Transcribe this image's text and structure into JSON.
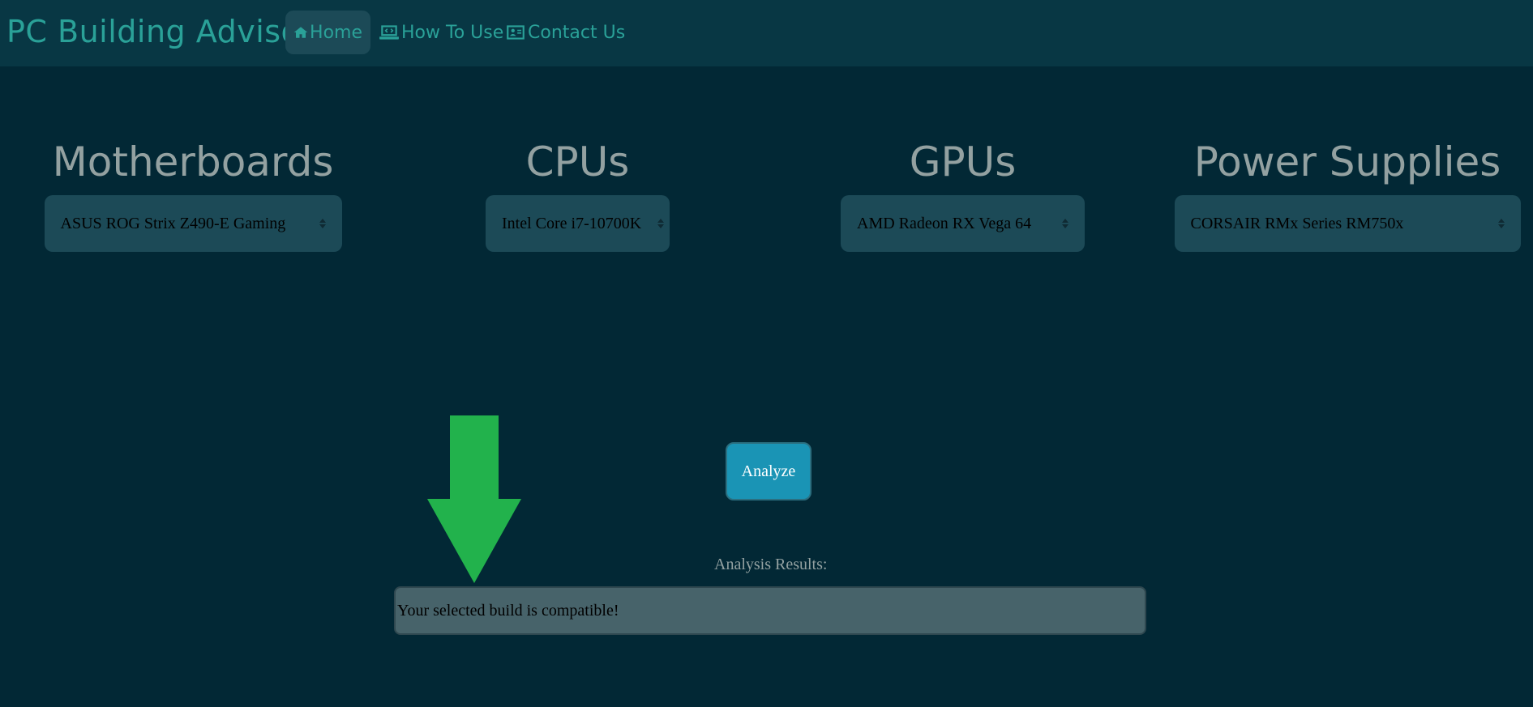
{
  "app": {
    "brand": "PC Building Advisor"
  },
  "nav": {
    "home": "Home",
    "how_to_use": "How To Use",
    "contact_us": "Contact Us"
  },
  "components": {
    "motherboards": {
      "heading": "Motherboards",
      "selected": "ASUS ROG Strix Z490-E Gaming"
    },
    "cpus": {
      "heading": "CPUs",
      "selected": "Intel Core i7-10700K"
    },
    "gpus": {
      "heading": "GPUs",
      "selected": "AMD Radeon RX Vega 64"
    },
    "power_supplies": {
      "heading": "Power Supplies",
      "selected": "CORSAIR RMx Series RM750x"
    }
  },
  "analyze": {
    "label": "Analyze"
  },
  "results": {
    "label": "Analysis Results:",
    "text": "Your selected build is compatible!"
  },
  "colors": {
    "background": "#022835",
    "navbar": "#083744",
    "accent": "#2aa198",
    "button": "#1a94b5",
    "annotation_arrow": "#22b24c"
  },
  "icons": {
    "home": "home-icon",
    "how_to_use": "laptop-code-icon",
    "contact_us": "address-card-icon",
    "select_arrows": "sort-arrows-icon",
    "annotation": "down-arrow-icon"
  }
}
